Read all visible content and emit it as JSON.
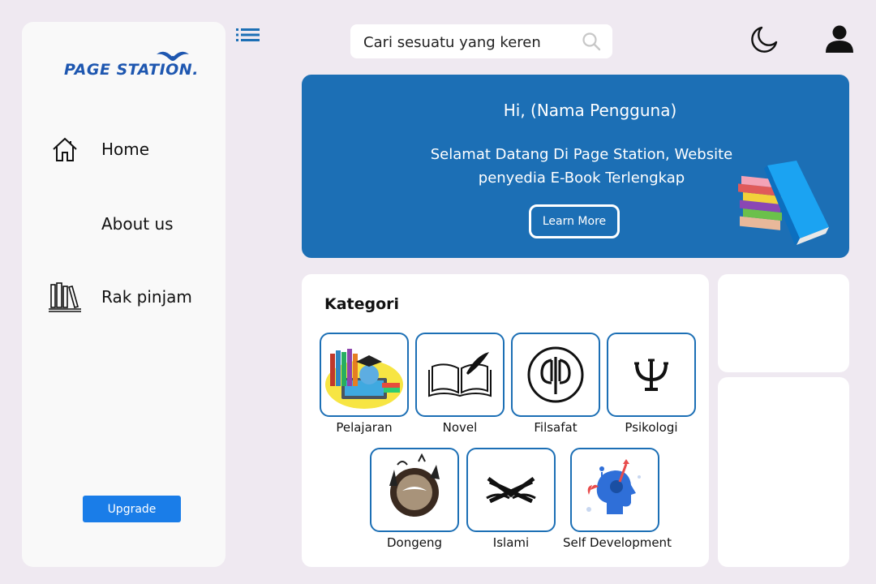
{
  "brand": {
    "logo_text": "PAGE STATION."
  },
  "sidebar": {
    "items": [
      {
        "label": "Home",
        "icon": "home-icon"
      },
      {
        "label": "About us",
        "icon": ""
      },
      {
        "label": "Rak pinjam",
        "icon": "bookshelf-icon"
      }
    ],
    "upgrade_label": "Upgrade"
  },
  "search": {
    "placeholder": "Cari sesuatu yang keren"
  },
  "hero": {
    "greeting": "Hi, (Nama Pengguna)",
    "welcome": "Selamat Datang Di Page Station, Website penyedia E-Book Terlengkap",
    "cta_label": "Learn More"
  },
  "kategori": {
    "title": "Kategori",
    "items": [
      {
        "label": "Pelajaran",
        "icon": "books-laptop-icon"
      },
      {
        "label": "Novel",
        "icon": "open-book-quill-icon"
      },
      {
        "label": "Filsafat",
        "icon": "phi-symbol-icon"
      },
      {
        "label": "Psikologi",
        "icon": "psi-symbol-icon"
      },
      {
        "label": "Dongeng",
        "icon": "fairytale-icon"
      },
      {
        "label": "Islami",
        "icon": "quran-stand-icon"
      },
      {
        "label": "Self Development",
        "icon": "head-growth-icon"
      }
    ]
  },
  "colors": {
    "background": "#efe9f1",
    "accent": "#1c6fb5",
    "upgrade": "#1a7de8",
    "brand": "#1e57b0"
  }
}
